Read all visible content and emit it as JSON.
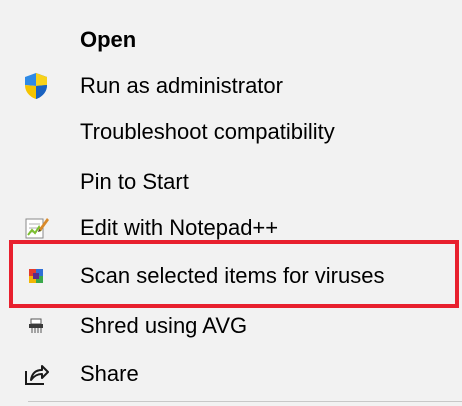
{
  "context_menu": {
    "items": [
      {
        "label": "Open",
        "icon": null
      },
      {
        "label": "Run as administrator",
        "icon": "uac-shield-icon"
      },
      {
        "label": "Troubleshoot compatibility",
        "icon": null
      },
      {
        "label": "Pin to Start",
        "icon": null
      },
      {
        "label": "Edit with Notepad++",
        "icon": "notepad-plus-plus-icon"
      },
      {
        "label": "Scan selected items for viruses",
        "icon": "avg-scan-icon"
      },
      {
        "label": "Shred using AVG",
        "icon": "shredder-icon"
      },
      {
        "label": "Share",
        "icon": "share-icon"
      }
    ]
  },
  "colors": {
    "menu_background": "#f2f2f2",
    "text": "#000000",
    "highlight_border": "#e8202e",
    "separator": "#c8c8c8"
  }
}
